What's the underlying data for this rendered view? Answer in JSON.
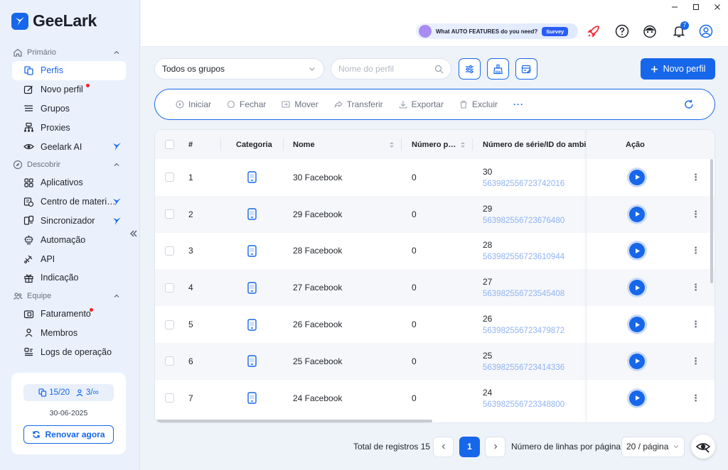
{
  "app": {
    "name": "GeeLark"
  },
  "colors": {
    "accent": "#1767ea",
    "notification_dot": "#f5222d",
    "serial_id": "#8fb3f4"
  },
  "sidebar": {
    "sections": [
      {
        "label": "Primário",
        "icon": "home-icon"
      },
      {
        "label": "Descobrir",
        "icon": "compass-icon"
      },
      {
        "label": "Equipe",
        "icon": "team-icon"
      }
    ],
    "items": [
      {
        "label": "Perfis",
        "icon": "profiles-icon",
        "active": true
      },
      {
        "label": "Novo perfil",
        "icon": "edit-icon",
        "dot": true
      },
      {
        "label": "Grupos",
        "icon": "list-icon"
      },
      {
        "label": "Proxies",
        "icon": "proxy-icon"
      },
      {
        "label": "Geelark AI",
        "icon": "eye-ai-icon",
        "badge": "geelark-bird"
      },
      {
        "label": "Aplicativos",
        "icon": "apps-icon"
      },
      {
        "label": "Centro de materi…",
        "icon": "material-icon",
        "badge": "geelark-bird"
      },
      {
        "label": "Sincronizador",
        "icon": "sync-icon",
        "badge": "geelark-bird"
      },
      {
        "label": "Automação",
        "icon": "robot-icon"
      },
      {
        "label": "API",
        "icon": "api-icon"
      },
      {
        "label": "Indicação",
        "icon": "gift-icon"
      },
      {
        "label": "Faturamento",
        "icon": "billing-icon",
        "dot": true
      },
      {
        "label": "Membros",
        "icon": "members-icon"
      },
      {
        "label": "Logs de operação",
        "icon": "logs-icon"
      }
    ],
    "plan": {
      "profiles": "15/20",
      "members": "3/∞",
      "expiry": "30-06-2025",
      "renew_label": "Renovar agora"
    }
  },
  "topbar": {
    "survey_prefix": "What ",
    "survey_bold": "AUTO FEATURES",
    "survey_suffix": " do you need?",
    "survey_badge": "Survey",
    "notification_count": "7"
  },
  "filters": {
    "group_select": "Todos os grupos",
    "search_placeholder": "Nome do perfil",
    "new_profile_label": "Novo perfil"
  },
  "actions": {
    "start": "Iniciar",
    "close": "Fechar",
    "move": "Mover",
    "transfer": "Transferir",
    "export": "Exportar",
    "delete": "Excluir",
    "more": "···"
  },
  "table": {
    "headers": {
      "index": "#",
      "category": "Categoria",
      "name": "Nome",
      "number": "Número p…",
      "serial": "Número de série/ID do ambien",
      "action": "Ação"
    },
    "rows": [
      {
        "index": "1",
        "name": "30 Facebook",
        "number": "0",
        "serial": "30",
        "env_id": "563982556723742016"
      },
      {
        "index": "2",
        "name": "29 Facebook",
        "number": "0",
        "serial": "29",
        "env_id": "563982556723676480"
      },
      {
        "index": "3",
        "name": "28 Facebook",
        "number": "0",
        "serial": "28",
        "env_id": "563982556723610944"
      },
      {
        "index": "4",
        "name": "27 Facebook",
        "number": "0",
        "serial": "27",
        "env_id": "563982556723545408"
      },
      {
        "index": "5",
        "name": "26 Facebook",
        "number": "0",
        "serial": "26",
        "env_id": "563982556723479872"
      },
      {
        "index": "6",
        "name": "25 Facebook",
        "number": "0",
        "serial": "25",
        "env_id": "563982556723414336"
      },
      {
        "index": "7",
        "name": "24 Facebook",
        "number": "0",
        "serial": "24",
        "env_id": "563982556723348800"
      }
    ]
  },
  "pagination": {
    "total_label": "Total de registros 15",
    "current_page": "1",
    "rows_per_page_label": "Número de linhas por página",
    "page_size": "20 / página"
  }
}
